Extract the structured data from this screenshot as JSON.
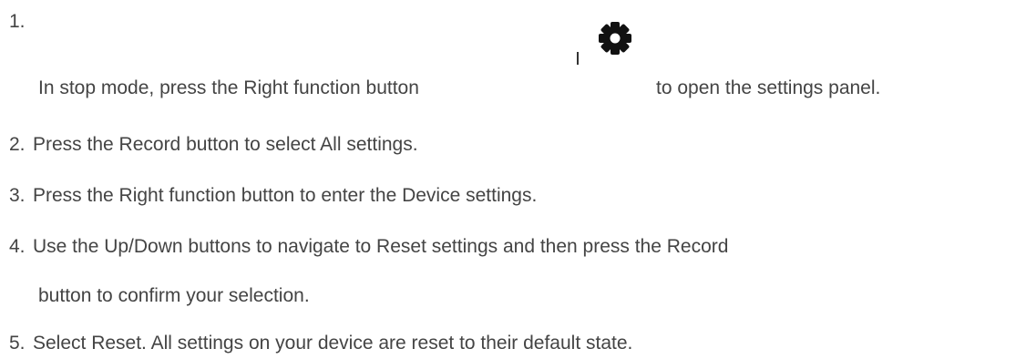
{
  "steps": [
    {
      "number": "1.",
      "text_before": "In stop mode, press the Right function button",
      "icon": "gear-icon",
      "text_after": "to open the settings panel."
    },
    {
      "number": "2.",
      "text": "Press the Record button to select All settings."
    },
    {
      "number": "3.",
      "text": "Press the Right function button to enter the Device settings."
    },
    {
      "number": "4.",
      "text_line1": "Use the Up/Down buttons to navigate to Reset settings and then press the Record",
      "text_line2": "button to confirm your selection."
    },
    {
      "number": "5.",
      "text": "Select Reset. All settings on your device are reset to their default state."
    }
  ],
  "colors": {
    "text": "#444444",
    "icon": "#111111"
  }
}
